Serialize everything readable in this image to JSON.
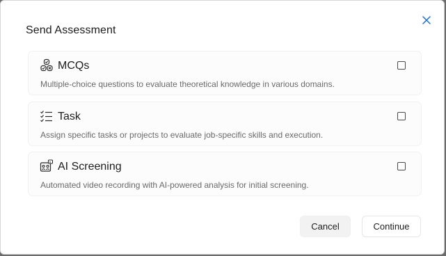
{
  "dialog": {
    "title": "Send Assessment",
    "close_icon": "close-icon",
    "accent_color": "#1a6fd6"
  },
  "options": [
    {
      "icon": "mcq-icon",
      "title": "MCQs",
      "description": "Multiple-choice questions to evaluate theoretical knowledge in various domains.",
      "checked": false
    },
    {
      "icon": "task-list-icon",
      "title": "Task",
      "description": "Assign specific tasks or projects to evaluate job-specific skills and execution.",
      "checked": false
    },
    {
      "icon": "ai-screening-icon",
      "title": "AI Screening",
      "description": "Automated video recording with AI-powered analysis for initial screening.",
      "checked": false
    }
  ],
  "footer": {
    "cancel_label": "Cancel",
    "continue_label": "Continue"
  }
}
